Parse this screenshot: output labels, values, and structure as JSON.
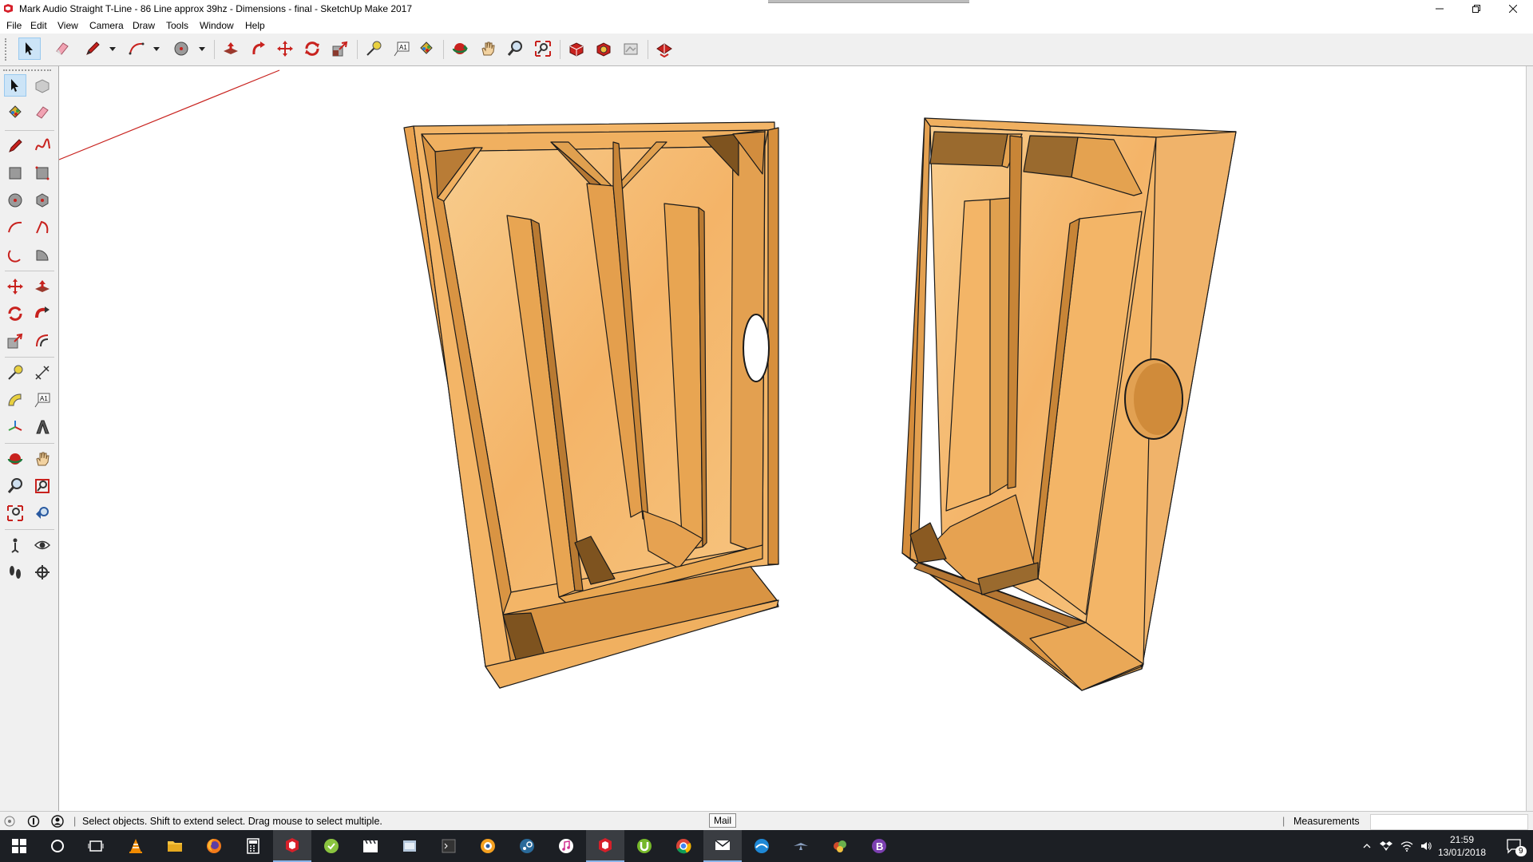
{
  "window": {
    "title": "Mark Audio Straight T-Line - 86 Line approx 39hz - Dimensions - final - SketchUp Make 2017",
    "controls": [
      "minimize",
      "restore",
      "close"
    ]
  },
  "menu": [
    "File",
    "Edit",
    "View",
    "Camera",
    "Draw",
    "Tools",
    "Window",
    "Help"
  ],
  "toolbar": {
    "tools": [
      "select-icon",
      "eraser-icon",
      "pencil-icon",
      "arc-icon",
      "circle-icon",
      "push-pull-icon",
      "follow-me-icon",
      "move-icon",
      "rotate-icon",
      "scale-icon",
      "tape-measure-icon",
      "text-icon",
      "paint-bucket-icon",
      "orbit-icon",
      "pan-icon",
      "zoom-icon",
      "zoom-extents-icon",
      "warehouse-icon",
      "extension-warehouse-icon",
      "layout-icon",
      "extension-manager-icon"
    ]
  },
  "status": {
    "hint": "Select objects. Shift to extend select. Drag mouse to select multiple.",
    "measurements_label": "Measurements",
    "measurements_value": "",
    "tooltip": "Mail"
  },
  "taskbar": {
    "time": "21:59",
    "date": "13/01/2018",
    "notifications": "9"
  },
  "colors": {
    "wood_light": "#f7c27e",
    "wood_mid": "#e9a24f",
    "wood_edge": "#d08b34",
    "wood_dark": "#9b6a2e",
    "taskbar": "#1c1f24",
    "selection": "#cce4f7"
  }
}
